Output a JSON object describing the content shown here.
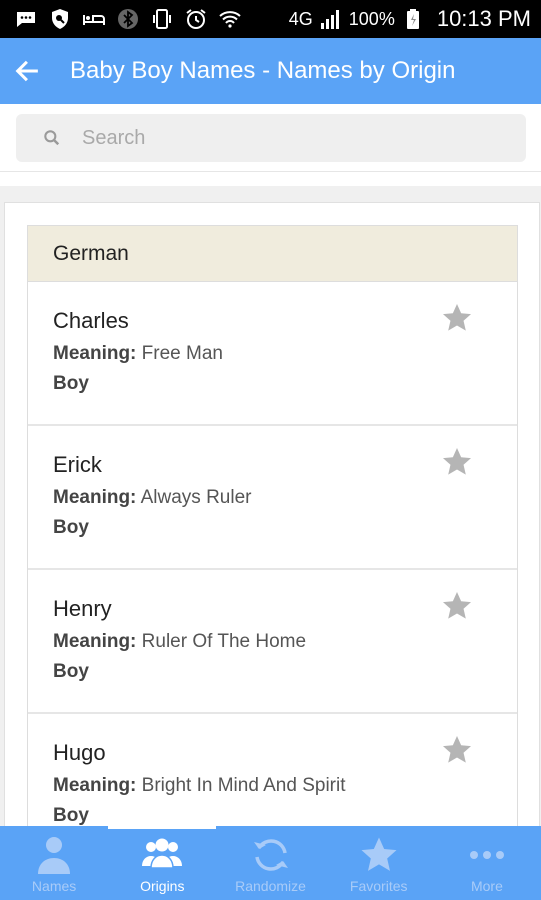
{
  "status_bar": {
    "network": "4G",
    "battery": "100%",
    "time": "10:13 PM",
    "icons": [
      "message-icon",
      "shield-icon",
      "bed-icon",
      "bluetooth-icon",
      "vibrate-icon",
      "alarm-icon",
      "wifi-icon",
      "signal-icon",
      "battery-icon"
    ]
  },
  "app_bar": {
    "back_icon": "arrow-left-icon",
    "title": "Baby Boy Names - Names by Origin"
  },
  "search": {
    "placeholder": "Search",
    "value": ""
  },
  "group": {
    "header": "German",
    "meaning_label": "Meaning:",
    "items": [
      {
        "name": "Charles",
        "meaning": "Free Man",
        "gender": "Boy"
      },
      {
        "name": "Erick",
        "meaning": "Always Ruler",
        "gender": "Boy"
      },
      {
        "name": "Henry",
        "meaning": "Ruler Of The Home",
        "gender": "Boy"
      },
      {
        "name": "Hugo",
        "meaning": "Bright In Mind And Spirit",
        "gender": "Boy"
      }
    ]
  },
  "bottom_nav": {
    "active": "Origins",
    "items": [
      {
        "label": "Names",
        "icon": "person-icon"
      },
      {
        "label": "Origins",
        "icon": "people-icon"
      },
      {
        "label": "Randomize",
        "icon": "refresh-icon"
      },
      {
        "label": "Favorites",
        "icon": "star-icon"
      },
      {
        "label": "More",
        "icon": "more-dots-icon"
      }
    ]
  },
  "colors": {
    "primary": "#5aa3f6",
    "header_bg": "#f0ecdd",
    "star": "#b5b5b5",
    "nav_inactive": "#a8cbf8"
  }
}
